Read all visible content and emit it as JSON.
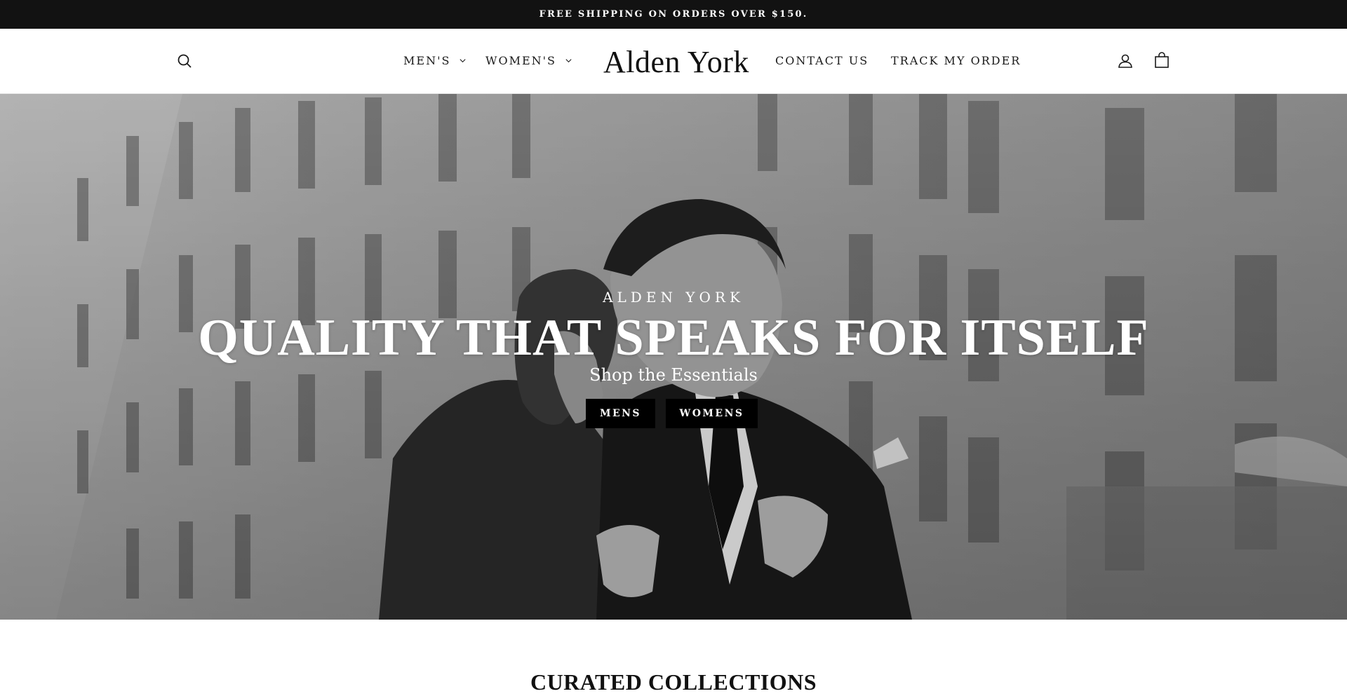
{
  "announcement": {
    "text": "FREE SHIPPING ON ORDERS OVER $150."
  },
  "header": {
    "logo": "Alden York",
    "nav": {
      "mens": "MEN'S",
      "womens": "WOMEN'S",
      "contact": "CONTACT US",
      "track": "TRACK MY ORDER"
    },
    "icons": [
      "search-icon",
      "user-icon",
      "shopping-bag-icon",
      "chevron-down-icon"
    ]
  },
  "hero": {
    "eyebrow": "ALDEN YORK",
    "title": "QUALITY THAT SPEAKS FOR ITSELF",
    "subtitle": "Shop the Essentials",
    "buttons": {
      "mens": "MENS",
      "womens": "WOMENS"
    }
  },
  "collections": {
    "title": "CURATED COLLECTIONS"
  },
  "colors": {
    "announcement_bg": "#121212",
    "button_bg": "#000000",
    "text": "#111111"
  }
}
